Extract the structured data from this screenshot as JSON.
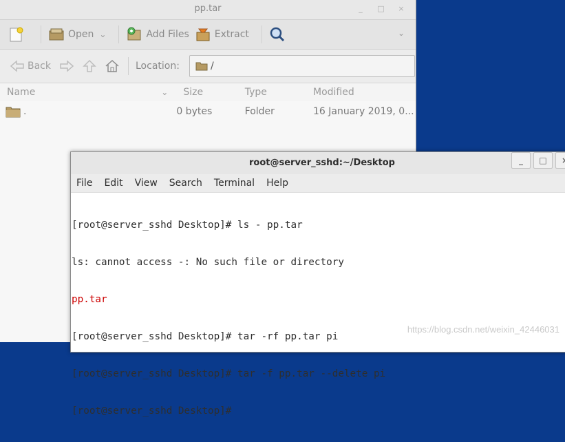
{
  "archive_window": {
    "title": "pp.tar",
    "window_controls": [
      "_",
      "□",
      "×"
    ],
    "toolbar": {
      "new_icon": "new-archive-icon",
      "open_label": "Open",
      "add_files_label": "Add Files",
      "extract_label": "Extract",
      "search_icon": "search-icon"
    },
    "navbar": {
      "back_label": "Back",
      "location_label": "Location:",
      "location_value": "/"
    },
    "columns": [
      "Name",
      "Size",
      "Type",
      "Modified"
    ],
    "rows": [
      {
        "name": ".",
        "size": "0 bytes",
        "type": "Folder",
        "modified": "16 January 2019, 0..."
      }
    ]
  },
  "terminal_window": {
    "title": "root@server_sshd:~/Desktop",
    "window_controls": [
      "_",
      "□",
      "×"
    ],
    "menu": [
      "File",
      "Edit",
      "View",
      "Search",
      "Terminal",
      "Help"
    ],
    "lines": [
      "[root@server_sshd Desktop]# ls - pp.tar",
      "ls: cannot access -: No such file or directory",
      "pp.tar",
      "[root@server_sshd Desktop]# tar -rf pp.tar pi",
      "[root@server_sshd Desktop]# tar -f pp.tar --delete pi",
      "[root@server_sshd Desktop]# "
    ]
  },
  "watermark": "https://blog.csdn.net/weixin_42446031",
  "colors": {
    "desktop": "#0a3a8c",
    "error_file": "#cc0000"
  }
}
